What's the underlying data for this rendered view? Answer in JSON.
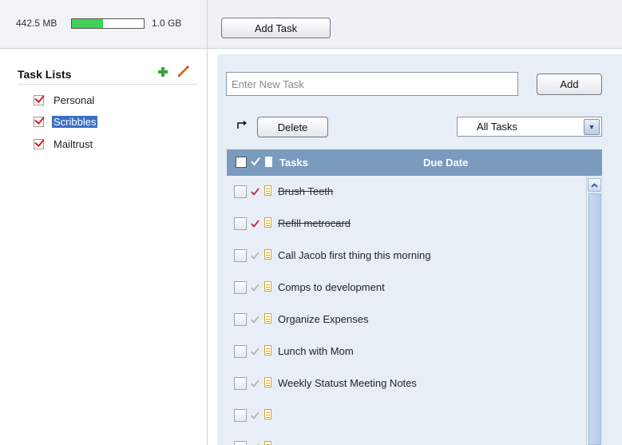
{
  "storage": {
    "used": "442.5 MB",
    "total": "1.0 GB",
    "usage_fraction": 0.43
  },
  "toolbar": {
    "add_task_label": "Add Task"
  },
  "task_lists": {
    "title": "Task Lists",
    "items": [
      {
        "label": "Personal",
        "selected": false
      },
      {
        "label": "Scribbles",
        "selected": true
      },
      {
        "label": "Mailtrust",
        "selected": false
      }
    ]
  },
  "new_task": {
    "placeholder": "Enter New Task",
    "add_label": "Add"
  },
  "actions": {
    "delete_label": "Delete",
    "filter_value": "All Tasks"
  },
  "table": {
    "headers": {
      "tasks": "Tasks",
      "due_date": "Due Date"
    },
    "rows": [
      {
        "text": "Brush Teeth",
        "done": true
      },
      {
        "text": "Refill metrocard",
        "done": true
      },
      {
        "text": "Call Jacob first thing this morning",
        "done": false
      },
      {
        "text": "Comps to development",
        "done": false
      },
      {
        "text": "Organize Expenses",
        "done": false
      },
      {
        "text": "Lunch with Mom",
        "done": false
      },
      {
        "text": "Weekly Statust Meeting Notes",
        "done": false
      },
      {
        "text": "",
        "done": false
      },
      {
        "text": "",
        "done": false
      }
    ]
  },
  "colors": {
    "storage_fill": "#41d157",
    "header_bg": "#7a9bbd",
    "done_check": "#c0203a",
    "pending_check": "#b5b5b5",
    "selected_list": "#3b6fc4"
  },
  "icons": {
    "add_list": "plus-icon",
    "edit_list": "pencil-icon",
    "list_check": "checkbox-checked-icon",
    "delete_arrow": "arrow-icon",
    "note": "note-icon",
    "complete": "check-icon"
  }
}
